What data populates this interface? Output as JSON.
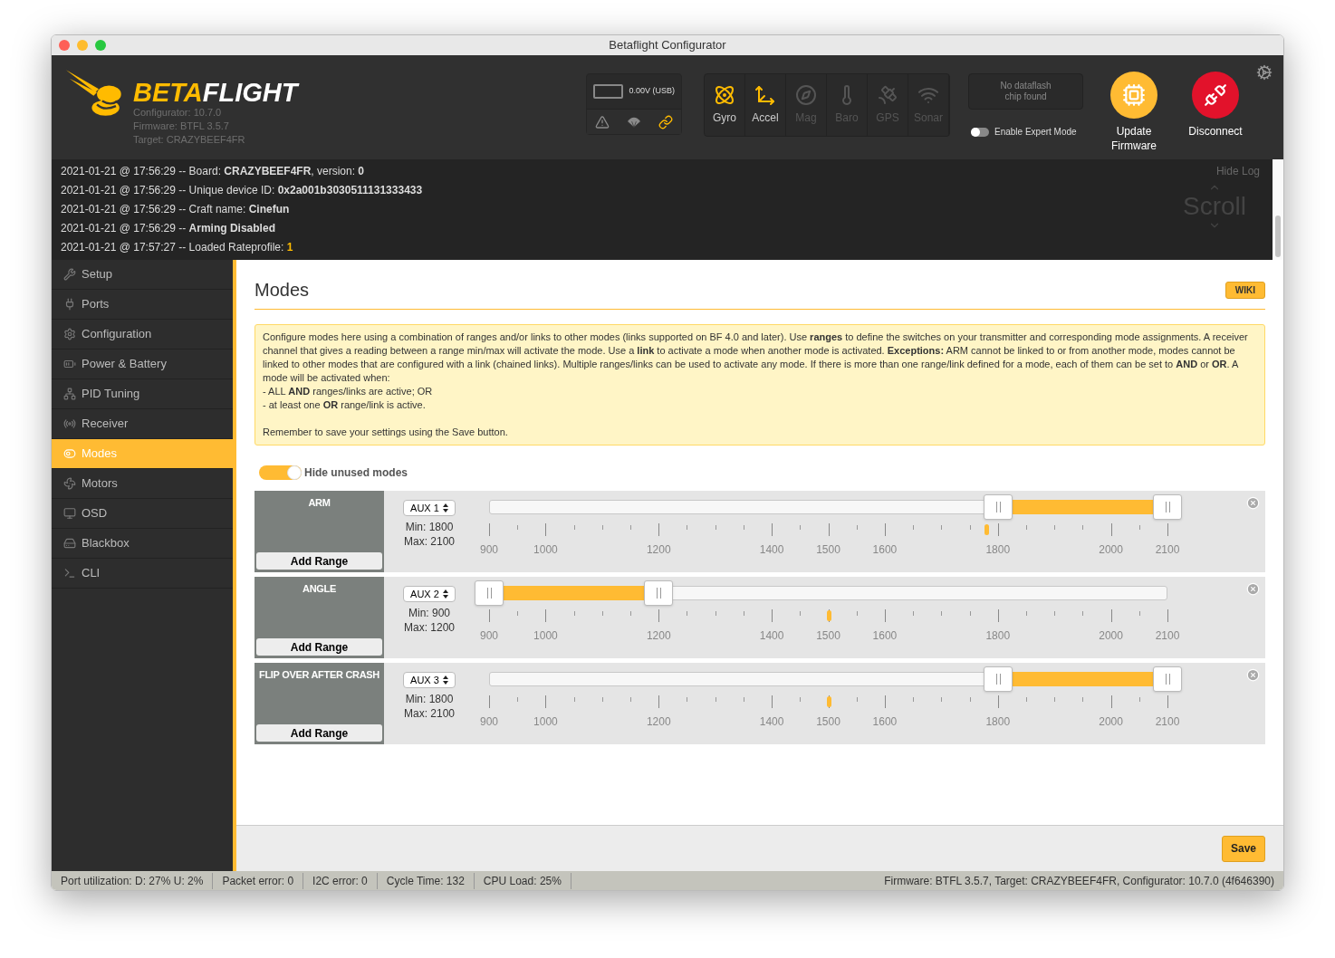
{
  "window": {
    "title": "Betaflight Configurator"
  },
  "header": {
    "logo": {
      "part_1": "BETA",
      "part_2": "FLIGHT"
    },
    "versions": [
      "Configurator: 10.7.0",
      "Firmware: BTFL 3.5.7",
      "Target: CRAZYBEEF4FR"
    ],
    "battery": {
      "reading": "0.00V (USB)"
    },
    "status_icons": [
      {
        "kind": "warning",
        "on": false
      },
      {
        "kind": "parachute",
        "on": false
      },
      {
        "kind": "link",
        "on": true
      }
    ],
    "sensors": [
      {
        "kind": "gyro",
        "label": "Gyro",
        "on": true
      },
      {
        "kind": "accel",
        "label": "Accel",
        "on": true
      },
      {
        "kind": "mag",
        "label": "Mag",
        "on": false
      },
      {
        "kind": "baro",
        "label": "Baro",
        "on": false
      },
      {
        "kind": "gps",
        "label": "GPS",
        "on": false
      },
      {
        "kind": "sonar",
        "label": "Sonar",
        "on": false
      }
    ],
    "dataflash": "No dataflash chip found",
    "expert_mode": {
      "label": "Enable Expert Mode",
      "on": false
    },
    "buttons": [
      {
        "kind": "update",
        "label": "Update Firmware"
      },
      {
        "kind": "disconnect",
        "label": "Disconnect"
      }
    ]
  },
  "log": {
    "lines": [
      {
        "text": "2021-01-21 @ 17:56:29 -- Board: **CRAZYBEEF4FR**, version: **0**"
      },
      {
        "text": "2021-01-21 @ 17:56:29 -- Unique device ID: **0x2a001b3030511131333433**"
      },
      {
        "text": "2021-01-21 @ 17:56:29 -- Craft name: **Cinefun**"
      },
      {
        "text": "2021-01-21 @ 17:56:29 -- **Arming Disabled**"
      },
      {
        "text": "2021-01-21 @ 17:57:27 -- Loaded Rateprofile:",
        "highlight": "1"
      }
    ],
    "hide_label": "Hide Log",
    "scroll_label": "Scroll"
  },
  "sidebar": {
    "items": [
      {
        "kind": "setup",
        "label": "Setup",
        "selected": false
      },
      {
        "kind": "ports",
        "label": "Ports",
        "selected": false
      },
      {
        "kind": "configuration",
        "label": "Configuration",
        "selected": false
      },
      {
        "kind": "power",
        "label": "Power & Battery",
        "selected": false
      },
      {
        "kind": "pid",
        "label": "PID Tuning",
        "selected": false
      },
      {
        "kind": "receiver",
        "label": "Receiver",
        "selected": false
      },
      {
        "kind": "modes",
        "label": "Modes",
        "selected": true
      },
      {
        "kind": "motors",
        "label": "Motors",
        "selected": false
      },
      {
        "kind": "osd",
        "label": "OSD",
        "selected": false
      },
      {
        "kind": "blackbox",
        "label": "Blackbox",
        "selected": false
      },
      {
        "kind": "cli",
        "label": "CLI",
        "selected": false
      }
    ]
  },
  "content": {
    "title": "Modes",
    "wiki": "WIKI",
    "help": [
      "Configure modes here using a combination of ranges and/or links to other modes (links supported on BF 4.0 and later). Use **ranges** to define the switches on your transmitter and corresponding mode assignments. A receiver channel that gives a reading between a range min/max will activate the mode. Use a **link** to activate a mode when another mode is activated. **Exceptions:** ARM cannot be linked to or from another mode, modes cannot be linked to other modes that are configured with a link (chained links). Multiple ranges/links can be used to activate any mode. If there is more than one range/link defined for a mode, each of them can be set to **AND** or **OR**. A mode will be activated when:",
      "- ALL **AND** ranges/links are active; OR",
      "- at least one **OR** range/link is active.",
      "Remember to save your settings using the Save button."
    ],
    "hide_unused": {
      "label": "Hide unused modes",
      "on": true
    },
    "modes": [
      {
        "name": "ARM",
        "add_label": "Add Range",
        "channel": "AUX 1",
        "min": "Min: 1800",
        "max": "Max: 2100",
        "range": {
          "from": {
            "level": 0.75
          },
          "to": {
            "level": 1
          }
        },
        "indicator": {
          "level": 0.733
        },
        "ticks": [
          {
            "label": "900",
            "level": 0
          },
          {
            "label": "1000",
            "level": 0.0833
          },
          {
            "label": "1200",
            "level": 0.25
          },
          {
            "label": "1400",
            "level": 0.4167
          },
          {
            "label": "1500",
            "level": 0.5
          },
          {
            "label": "1600",
            "level": 0.5833
          },
          {
            "label": "1800",
            "level": 0.75
          },
          {
            "label": "2000",
            "level": 0.9167
          },
          {
            "label": "2100",
            "level": 1
          }
        ]
      },
      {
        "name": "ANGLE",
        "add_label": "Add Range",
        "channel": "AUX 2",
        "min": "Min: 900",
        "max": "Max: 1200",
        "range": {
          "from": {
            "level": 0
          },
          "to": {
            "level": 0.25
          }
        },
        "indicator": {
          "level": 0.5
        },
        "ticks": [
          {
            "label": "900",
            "level": 0
          },
          {
            "label": "1000",
            "level": 0.0833
          },
          {
            "label": "1200",
            "level": 0.25
          },
          {
            "label": "1400",
            "level": 0.4167
          },
          {
            "label": "1500",
            "level": 0.5
          },
          {
            "label": "1600",
            "level": 0.5833
          },
          {
            "label": "1800",
            "level": 0.75
          },
          {
            "label": "2000",
            "level": 0.9167
          },
          {
            "label": "2100",
            "level": 1
          }
        ]
      },
      {
        "name": "FLIP OVER AFTER CRASH",
        "add_label": "Add Range",
        "channel": "AUX 3",
        "min": "Min: 1800",
        "max": "Max: 2100",
        "range": {
          "from": {
            "level": 0.75
          },
          "to": {
            "level": 1
          }
        },
        "indicator": {
          "level": 0.5
        },
        "ticks": [
          {
            "label": "900",
            "level": 0
          },
          {
            "label": "1000",
            "level": 0.0833
          },
          {
            "label": "1200",
            "level": 0.25
          },
          {
            "label": "1400",
            "level": 0.4167
          },
          {
            "label": "1500",
            "level": 0.5
          },
          {
            "label": "1600",
            "level": 0.5833
          },
          {
            "label": "1800",
            "level": 0.75
          },
          {
            "label": "2000",
            "level": 0.9167
          },
          {
            "label": "2100",
            "level": 1
          }
        ]
      }
    ],
    "save": "Save"
  },
  "status_bar": {
    "items": [
      "Port utilization: D: 27% U: 2%",
      "Packet error: 0",
      "I2C error: 0",
      "Cycle Time: 132",
      "CPU Load: 25%"
    ],
    "right": "Firmware: BTFL 3.5.7, Target: CRAZYBEEF4FR, Configurator: 10.7.0 (4f646390)"
  }
}
